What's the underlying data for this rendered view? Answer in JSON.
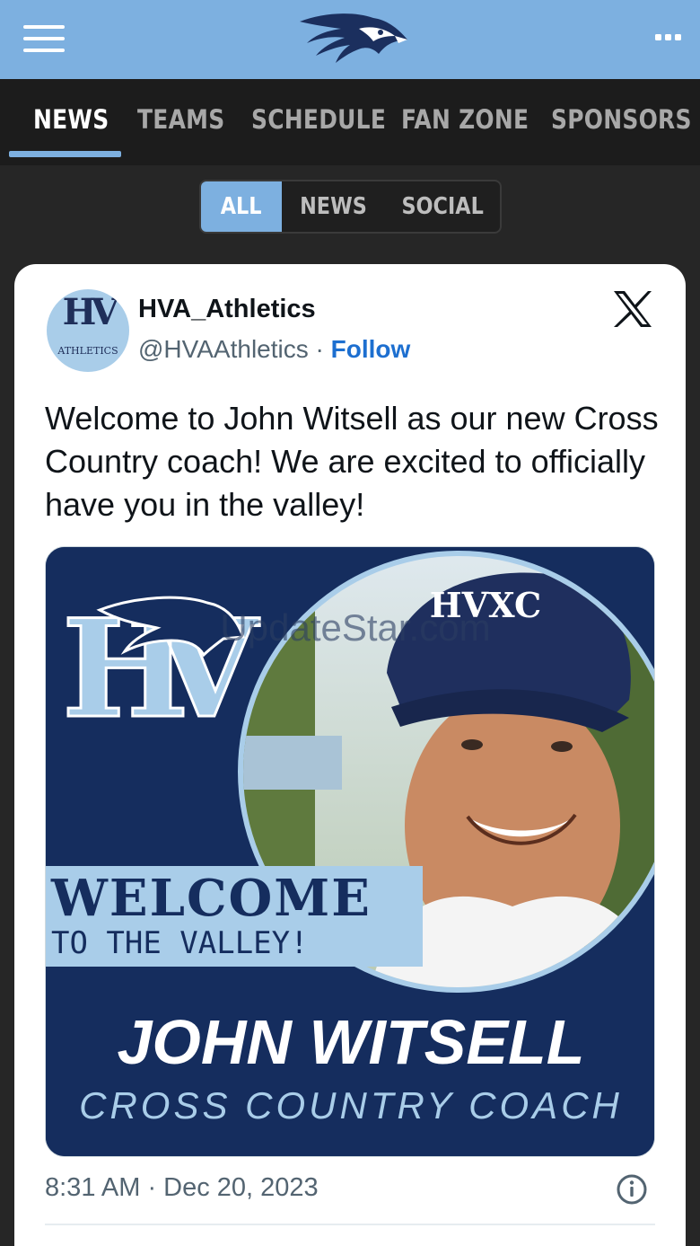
{
  "colors": {
    "accent": "#7db0e0",
    "navy": "#152d5e",
    "nav_bg": "#1c1c1c",
    "link": "#1d6fd0"
  },
  "header": {
    "menu_icon": "hamburger-icon",
    "logo": "hawk-logo",
    "more_icon": "more-dots-icon"
  },
  "nav": {
    "items": [
      {
        "label": "NEWS",
        "active": true
      },
      {
        "label": "TEAMS",
        "active": false
      },
      {
        "label": "SCHEDULE",
        "active": false
      },
      {
        "label": "FAN ZONE",
        "active": false
      },
      {
        "label": "SPONSORS",
        "active": false
      }
    ]
  },
  "filter": {
    "tabs": [
      {
        "label": "ALL",
        "active": true
      },
      {
        "label": "NEWS",
        "active": false
      },
      {
        "label": "SOCIAL",
        "active": false
      }
    ]
  },
  "post": {
    "avatar": {
      "monogram": "HV",
      "subtitle": "ATHLETICS"
    },
    "display_name": "HVA_Athletics",
    "handle": "@HVAAthletics",
    "separator": " · ",
    "follow_label": "Follow",
    "platform_icon": "x-logo-icon",
    "text": "Welcome to John Witsell as our new Cross Country coach! We are excited to officially have you in the valley!",
    "image": {
      "monogram": "HV",
      "cap_text": "HVXC",
      "watermark": "UpdateStar.com",
      "welcome": "WELCOME",
      "to_the_valley": "TO THE VALLEY!",
      "name": "JOHN WITSELL",
      "role": "CROSS COUNTRY COACH"
    },
    "timestamp": "8:31 AM · Dec 20, 2023",
    "info_icon": "info-icon"
  }
}
